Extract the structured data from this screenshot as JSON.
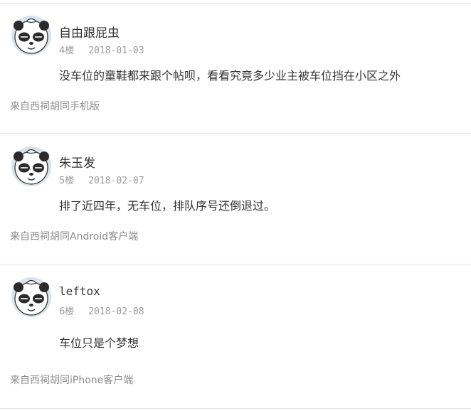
{
  "posts": [
    {
      "username": "自由跟屁虫",
      "floor": "4楼",
      "date": "2018-01-03",
      "content": "没车位的童鞋都来跟个帖呗，看看究竟多少业主被车位挡在小区之外",
      "source": "来自西祠胡同手机版",
      "avatar_icon": "panda-avatar-icon"
    },
    {
      "username": "朱玉发",
      "floor": "5楼",
      "date": "2018-02-07",
      "content": "排了近四年，无车位，排队序号还倒退过。",
      "source": "来自西祠胡同Android客户端",
      "avatar_icon": "panda-avatar-icon"
    },
    {
      "username": "leftox",
      "floor": "6楼",
      "date": "2018-02-08",
      "content": "车位只是个梦想",
      "source": "来自西祠胡同iPhone客户端",
      "avatar_icon": "panda-avatar-icon"
    }
  ],
  "colors": {
    "divider": "#e6e6e6",
    "text": "#333333",
    "meta": "#9a9a9a"
  }
}
